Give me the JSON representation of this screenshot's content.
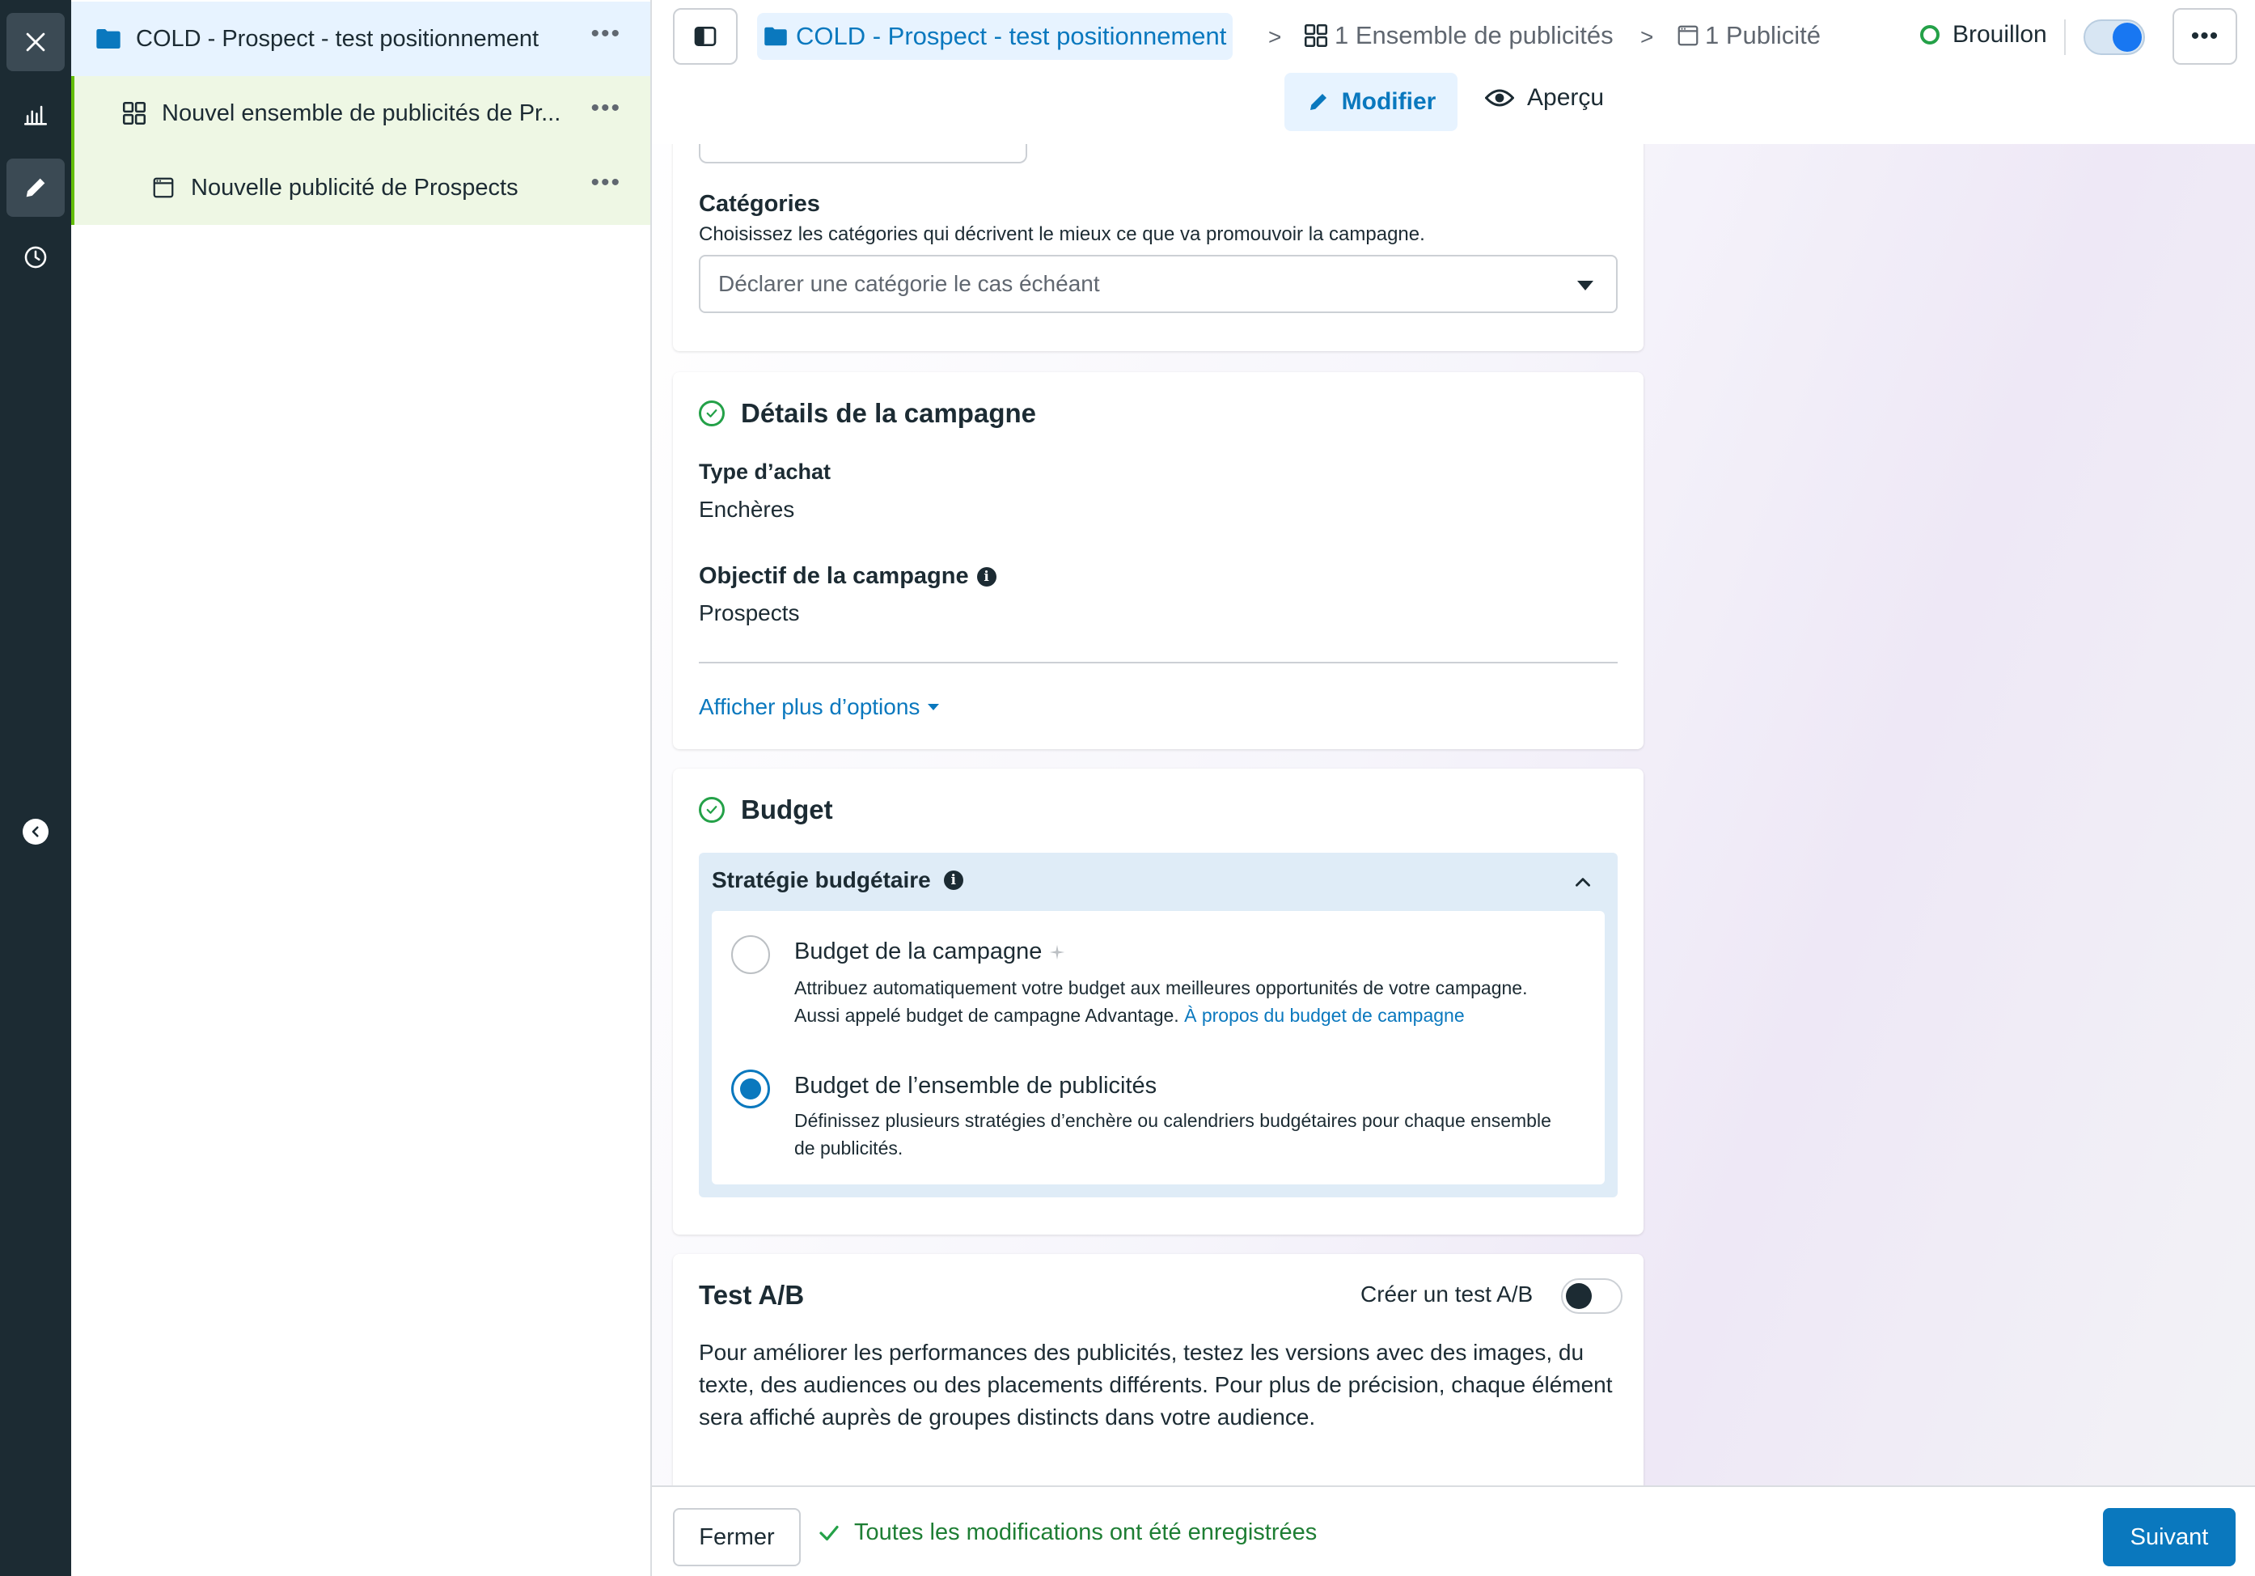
{
  "tree": {
    "campaign": "COLD - Prospect - test positionnement",
    "adset": "Nouvel ensemble de publicités de Pr...",
    "ad": "Nouvelle publicité de Prospects",
    "more_icon": "•••"
  },
  "header": {
    "breadcrumb_campaign": "COLD - Prospect - test positionnement",
    "breadcrumb_adsets": "1 Ensemble de publicités",
    "breadcrumb_ads": "1 Publicité",
    "separator": ">",
    "status": "Brouillon",
    "more_icon": "•••",
    "tab_edit": "Modifier",
    "tab_preview": "Aperçu"
  },
  "categories": {
    "label": "Catégories",
    "help": "Choisissez les catégories qui décrivent le mieux ce que va promouvoir la campagne.",
    "select_placeholder": "Déclarer une catégorie le cas échéant"
  },
  "details": {
    "title": "Détails de la campagne",
    "buy_type_label": "Type d’achat",
    "buy_type_value": "Enchères",
    "objective_label": "Objectif de la campagne",
    "objective_value": "Prospects",
    "more_options": "Afficher plus d’options"
  },
  "budget": {
    "title": "Budget",
    "strategy_label": "Stratégie budgétaire",
    "options": [
      {
        "title": "Budget de la campagne",
        "desc": "Attribuez automatiquement votre budget aux meilleures opportunités de votre campagne. Aussi appelé budget de campagne Advantage. ",
        "link": "À propos du budget de campagne",
        "selected": false
      },
      {
        "title": "Budget de l’ensemble de publicités",
        "desc": "Définissez plusieurs stratégies d’enchère ou calendriers budgétaires pour chaque ensemble de publicités.",
        "selected": true
      }
    ]
  },
  "ab_test": {
    "title": "Test A/B",
    "toggle_label": "Créer un test A/B",
    "toggle_on": false,
    "desc": "Pour améliorer les performances des publicités, testez les versions avec des images, du texte, des audiences ou des placements différents. Pour plus de précision, chaque élément sera affiché auprès de groupes distincts dans votre audience."
  },
  "footer": {
    "close": "Fermer",
    "save_status": "Toutes les modifications ont été enregistrées",
    "next": "Suivant"
  },
  "colors": {
    "accent": "#0a78be",
    "rail": "#1c2b33",
    "success": "#24a148",
    "selected_row": "#e7f3ff",
    "child_rows": "#eef7e4"
  }
}
